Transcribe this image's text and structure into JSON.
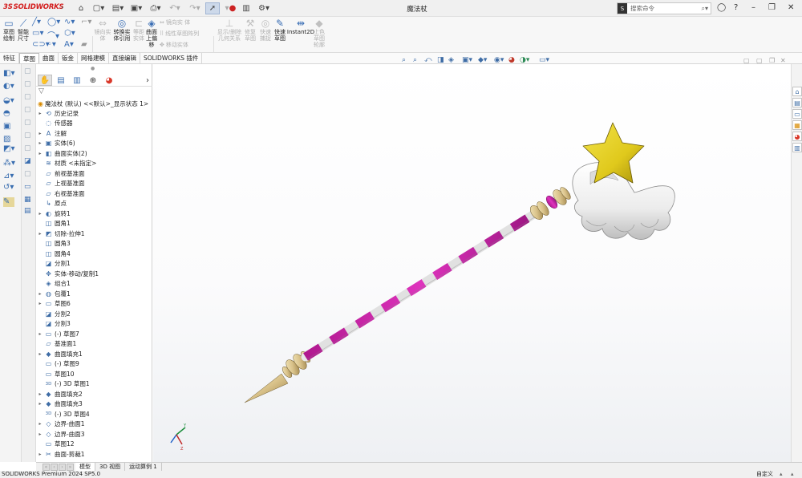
{
  "app": {
    "logo_text": "SOLIDWORKS",
    "document_title": "魔法杖"
  },
  "search": {
    "placeholder": "搜索命令"
  },
  "ribbon": {
    "sketch": "草图\n绘制",
    "smart_dim": "智能\n尺寸",
    "mirror_entities": "镜向实\n体",
    "linear_pattern": "线性草图阵列",
    "move_entities": "移动实体",
    "convert_entities": "转换实\n体引用",
    "offset_entities": "等距\n实体",
    "offset_on_surface": "曲面\n上偏\n移",
    "trim_entities": "剪裁\n实体",
    "display_delete": "显示/删除\n几何关系",
    "repair_sketch": "修复\n草图",
    "quick_snaps": "快速\n捕捉",
    "rapid_sketch": "快速\n草图",
    "instant2d": "Instant2D",
    "shaded_contours": "上色\n草图\n轮廓"
  },
  "tabs": [
    "特征",
    "草图",
    "曲面",
    "钣金",
    "网格建模",
    "直接编辑",
    "SOLIDWORKS 插件"
  ],
  "active_tab": "草图",
  "tree": {
    "root": "魔法杖 (默认) <<默认>_显示状态 1>",
    "items": [
      {
        "label": "历史记录",
        "icon": "history-icon",
        "exp": true
      },
      {
        "label": "传感器",
        "icon": "sensor-icon",
        "exp": false
      },
      {
        "label": "注解",
        "icon": "annotation-icon",
        "exp": true
      },
      {
        "label": "实体(6)",
        "icon": "solid-bodies-icon",
        "exp": true
      },
      {
        "label": "曲面实体(2)",
        "icon": "surface-bodies-icon",
        "exp": true
      },
      {
        "label": "材质 <未指定>",
        "icon": "material-icon",
        "exp": false
      },
      {
        "label": "前视基准面",
        "icon": "plane-icon",
        "exp": false
      },
      {
        "label": "上视基准面",
        "icon": "plane-icon",
        "exp": false
      },
      {
        "label": "右视基准面",
        "icon": "plane-icon",
        "exp": false
      },
      {
        "label": "原点",
        "icon": "origin-icon",
        "exp": false
      },
      {
        "label": "旋转1",
        "icon": "revolve-icon",
        "exp": true
      },
      {
        "label": "圆角1",
        "icon": "fillet-icon",
        "exp": false
      },
      {
        "label": "切除-拉伸1",
        "icon": "cut-extrude-icon",
        "exp": true
      },
      {
        "label": "圆角3",
        "icon": "fillet-icon",
        "exp": false
      },
      {
        "label": "圆角4",
        "icon": "fillet-icon",
        "exp": false
      },
      {
        "label": "分割1",
        "icon": "split-icon",
        "exp": false
      },
      {
        "label": "实体-移动/复制1",
        "icon": "move-copy-icon",
        "exp": false
      },
      {
        "label": "组合1",
        "icon": "combine-icon",
        "exp": false
      },
      {
        "label": "包覆1",
        "icon": "wrap-icon",
        "exp": true
      },
      {
        "label": "草图6",
        "icon": "sketch-icon",
        "exp": true
      },
      {
        "label": "分割2",
        "icon": "split-icon",
        "exp": false
      },
      {
        "label": "分割3",
        "icon": "split-icon",
        "exp": false
      },
      {
        "label": "(-) 草图7",
        "icon": "sketch-icon",
        "exp": true
      },
      {
        "label": "基准面1",
        "icon": "plane-icon",
        "exp": false
      },
      {
        "label": "曲面填充1",
        "icon": "fill-surface-icon",
        "exp": true
      },
      {
        "label": "(-) 草图9",
        "icon": "sketch-icon",
        "exp": false
      },
      {
        "label": "草图10",
        "icon": "sketch-icon",
        "exp": false
      },
      {
        "label": "(-) 3D 草图1",
        "icon": "3d-sketch-icon",
        "exp": false
      },
      {
        "label": "曲面填充2",
        "icon": "fill-surface-icon",
        "exp": true
      },
      {
        "label": "曲面填充3",
        "icon": "fill-surface-icon",
        "exp": true
      },
      {
        "label": "(-) 3D 草图4",
        "icon": "3d-sketch-icon",
        "exp": false
      },
      {
        "label": "边界-曲面1",
        "icon": "boundary-surface-icon",
        "exp": true
      },
      {
        "label": "边界-曲面3",
        "icon": "boundary-surface-icon",
        "exp": true
      },
      {
        "label": "草图12",
        "icon": "sketch-icon",
        "exp": false
      },
      {
        "label": "曲面-剪裁1",
        "icon": "trim-surface-icon",
        "exp": true
      }
    ]
  },
  "bottom_tabs": [
    "模型",
    "3D 视图",
    "运动算例 1"
  ],
  "status": {
    "left": "SOLIDWORKS Premium 2024 SP5.0",
    "right": "自定义"
  },
  "colors": {
    "ribbon_accent": "#3b6fb5",
    "wand_pink": "#c01d9e",
    "star_yellow": "#e7d11e",
    "gold": "#d9c28a"
  }
}
